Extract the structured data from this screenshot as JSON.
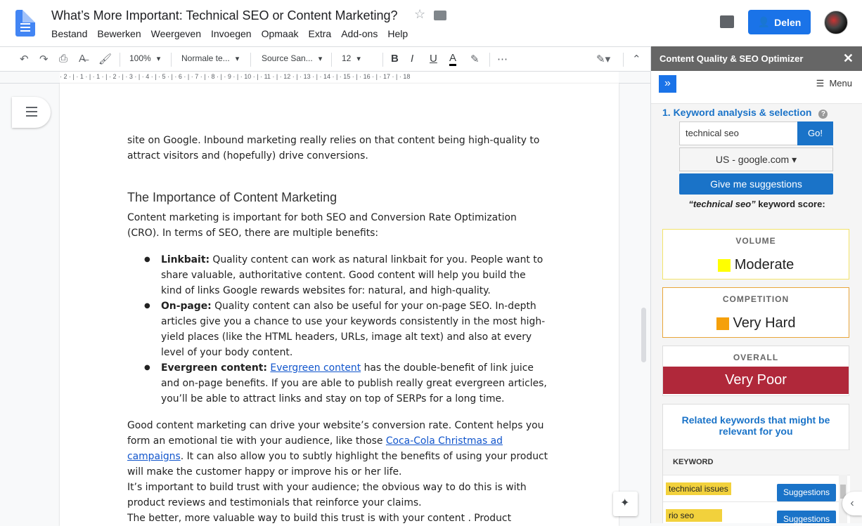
{
  "header": {
    "doc_title": "What’s More Important: Technical SEO or Content Marketing?",
    "menus": [
      "Bestand",
      "Bewerken",
      "Weergeven",
      "Invoegen",
      "Opmaak",
      "Extra",
      "Add-ons",
      "Help"
    ],
    "share_label": "Delen"
  },
  "toolbar": {
    "zoom": "100%",
    "style": "Normale te...",
    "font": "Source San...",
    "size": "12"
  },
  "ruler": "· 2 · | · 1 · |     · 1 · | · 2 · | · 3 · | · 4 · | · 5 · | · 6 · | · 7 · | · 8 · | · 9 · | · 10 · | · 11 · | · 12 · | · 13 · | · 14 · | · 15 · | · 16 · | · 17 · | · 18",
  "document": {
    "p1": "site on Google. Inbound marketing really relies on that content being high-quality to attract visitors and (hopefully) drive conversions.",
    "heading": "The Importance of Content Marketing",
    "p2": "Content marketing is important for both SEO and Conversion Rate Optimization (CRO). In terms of SEO, there are multiple benefits:",
    "b1_bold": "Linkbait:",
    "b1_text": " Quality content can work as natural linkbait for you. People want to share valuable, authoritative content. Good content will help you build the kind of links Google rewards websites for: natural, and high-quality.",
    "b2_bold": "On-page:",
    "b2_text": " Quality content can also be useful for your on-page SEO. In-depth articles give you a chance to use your keywords consistently in the most high-yield places (like the HTML headers, URLs, image alt text) and also at every level of your body content.",
    "b3_bold": "Evergreen content:",
    "b3_link": "Evergreen content",
    "b3_text": " has the double-benefit of link juice and on-page benefits. If you are able to publish really great evergreen articles, you’ll be able to attract links and stay on top of SERPs for a long time.",
    "p3_a": "Good content marketing can drive your website’s conversion rate. Content helps you form an emotional tie with your audience, like those ",
    "p3_link": "Coca-Cola Christmas ad campaigns",
    "p3_b": ". It can also allow you to subtly highlight the benefits of using your product will make the customer happy or improve his or her life.",
    "p4": "It’s important to build trust with your audience; the obvious way to do this is with product reviews and testimonials that reinforce your claims.",
    "p5": "The better, more valuable way to build this trust is with your content . Product"
  },
  "panel": {
    "title": "Content Quality & SEO Optimizer",
    "menu_label": "Menu",
    "section_title": "1. Keyword analysis & selection",
    "keyword_value": "technical seo",
    "go_label": "Go!",
    "country": "US - google.com ▾",
    "suggest_label": "Give me suggestions",
    "score_label_kw": "“technical seo”",
    "score_label_rest": " keyword score:",
    "volume_title": "VOLUME",
    "volume_value": "Moderate",
    "volume_color": "#ffff00",
    "competition_title": "COMPETITION",
    "competition_value": "Very Hard",
    "competition_color": "#f5a00a",
    "overall_title": "OVERALL",
    "overall_value": "Very Poor",
    "related_title": "Related keywords that might be relevant for you",
    "keyword_col": "KEYWORD",
    "related": [
      {
        "keyword": "technical issues",
        "button": "Suggestions"
      },
      {
        "keyword": "rio seo",
        "button": "Suggestions"
      }
    ]
  }
}
